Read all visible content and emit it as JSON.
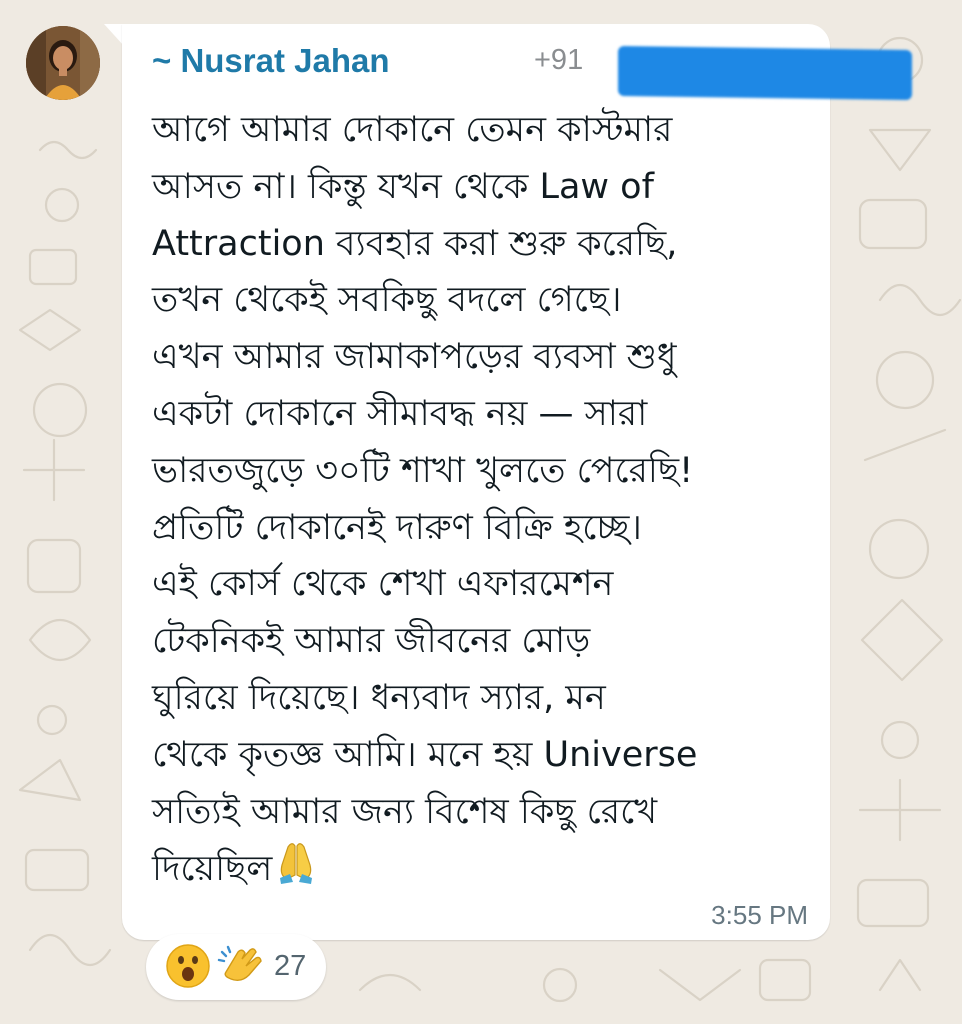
{
  "colors": {
    "background": "#efeae2",
    "bubble": "#ffffff",
    "sender_name": "#1f7aa8",
    "redaction": "#1e88e5",
    "timestamp": "#667781"
  },
  "avatar": {
    "icon": "profile-photo-woman"
  },
  "message": {
    "sender_name": "~ Nusrat Jahan",
    "sender_phone": "+91",
    "text": "আগে আমার দোকানে তেমন কাস্টমার\nআসত না। কিন্তু যখন থেকে Law of\nAttraction ব্যবহার করা শুরু করেছি,\nতখন থেকেই সবকিছু বদলে গেছে।\nএখন আমার জামাকাপড়ের ব্যবসা শুধু\nএকটা দোকানে সীমাবদ্ধ নয় — সারা\nভারতজুড়ে ৩০টি শাখা খুলতে পেরেছি!\nপ্রতিটি দোকানেই দারুণ বিক্রি হচ্ছে।\nএই কোর্স থেকে শেখা এফারমেশন\nটেকনিকই আমার জীবনের মোড়\nঘুরিয়ে দিয়েছে। ধন্যবাদ স্যার, মন\nথেকে কৃতজ্ঞ আমি। মনে হয় Universe\nসত্যিই আমার জন্য বিশেষ কিছু রেখে\nদিয়েছিল",
    "trailing_emoji": "folded-hands-icon",
    "time": "3:55 PM"
  },
  "reactions": {
    "emojis": [
      "astonished-face-icon",
      "clapping-hands-icon"
    ],
    "count": "27"
  }
}
